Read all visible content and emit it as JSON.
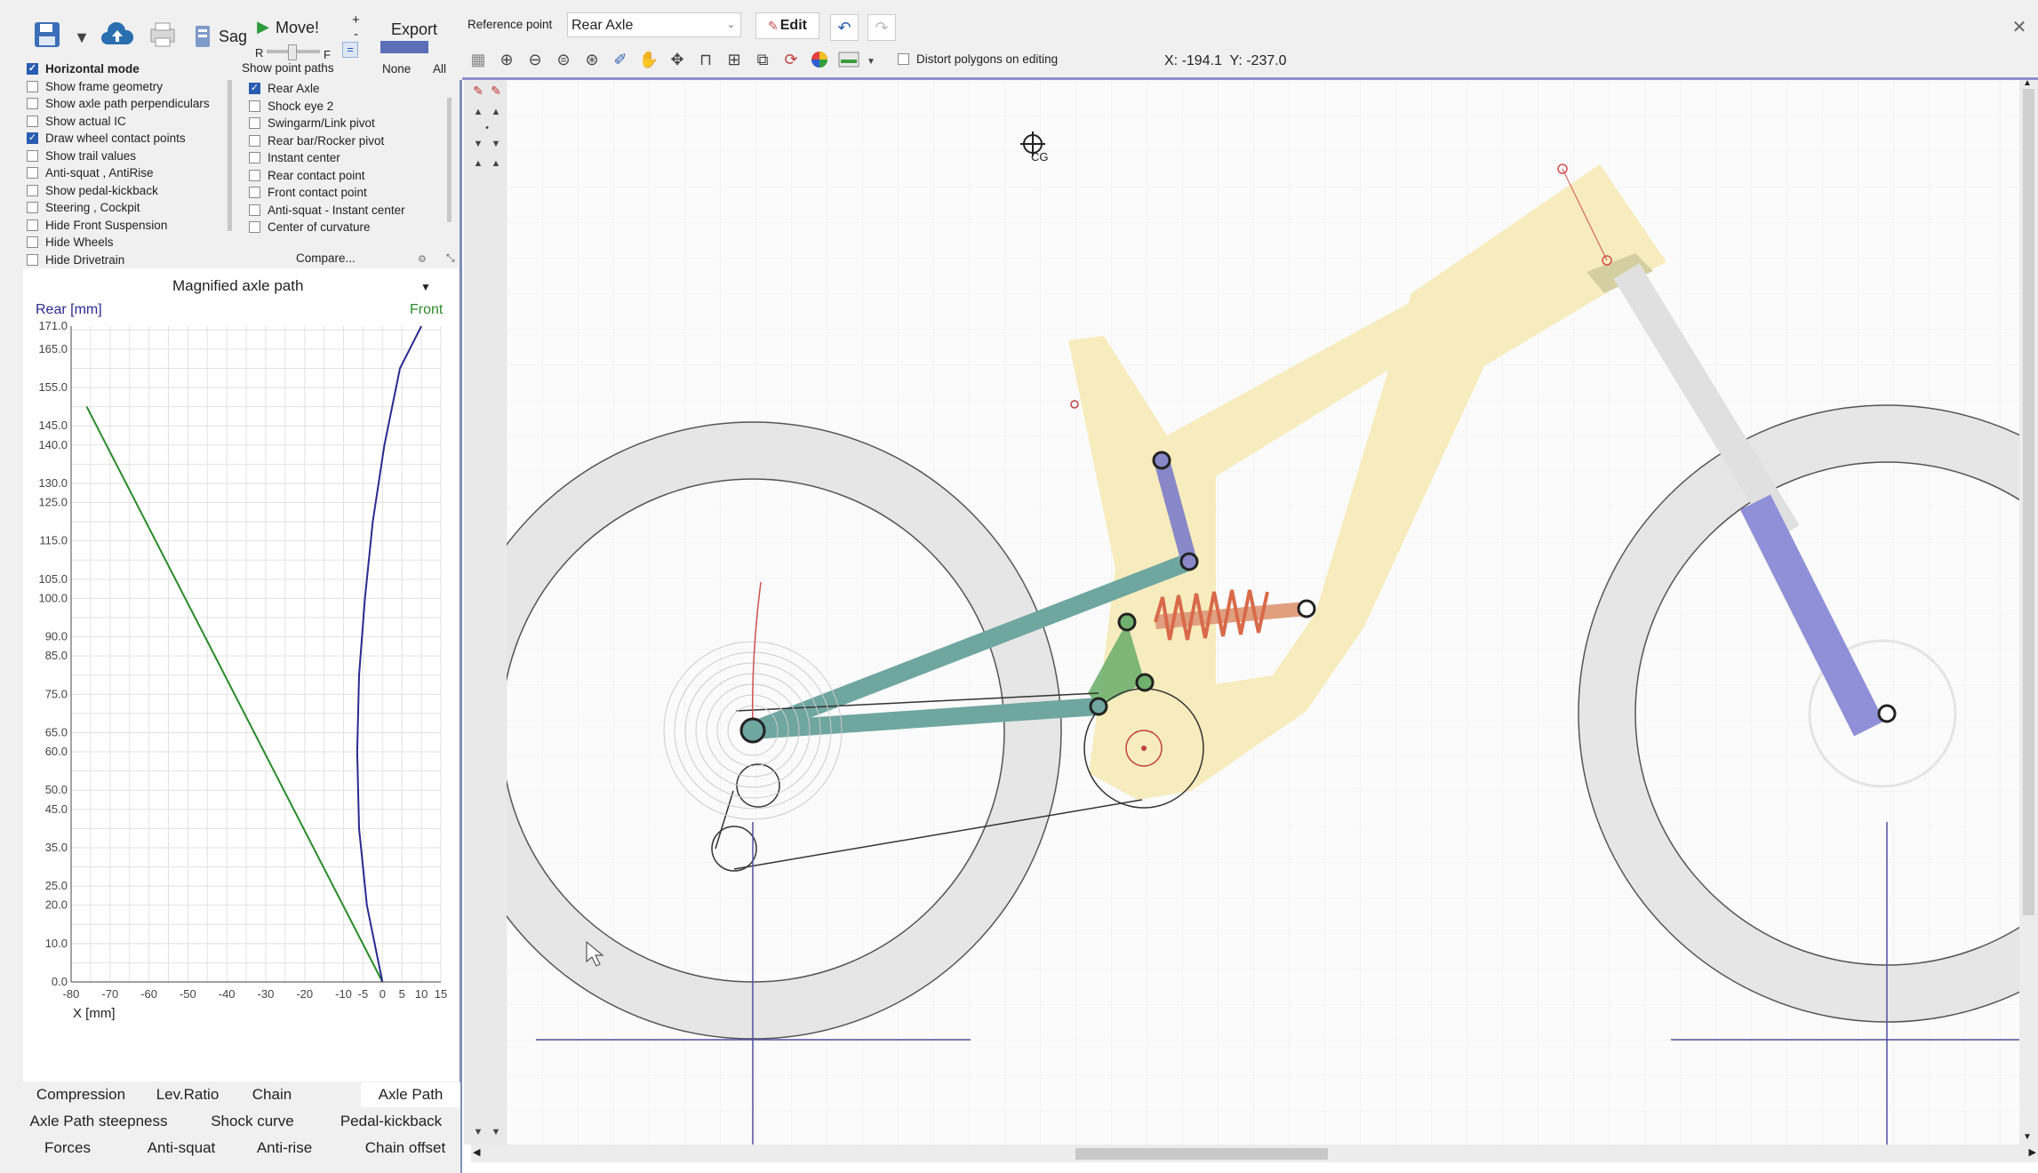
{
  "toolbar": {
    "sag_label": "Sag",
    "move_label": "Move!",
    "export_label": "Export",
    "slider_r": "R",
    "slider_f": "F",
    "plus_label": "+",
    "minus_label": "-",
    "equal_label": "="
  },
  "options": [
    {
      "label": "Horizontal mode",
      "checked": true,
      "bold": true
    },
    {
      "label": "Show frame geometry",
      "checked": false
    },
    {
      "label": "Show axle path perpendiculars",
      "checked": false
    },
    {
      "label": "Show actual IC",
      "checked": false
    },
    {
      "label": "Draw wheel contact points",
      "checked": true
    },
    {
      "label": "Show trail values",
      "checked": false
    },
    {
      "label": "Anti-squat , AntiRise",
      "checked": false
    },
    {
      "label": "Show pedal-kickback",
      "checked": false
    },
    {
      "label": "Steering , Cockpit",
      "checked": false
    },
    {
      "label": "Hide Front Suspension",
      "checked": false
    },
    {
      "label": "Hide Wheels",
      "checked": false
    },
    {
      "label": "Hide Drivetrain",
      "checked": false
    }
  ],
  "point_paths": {
    "header": "Show point paths",
    "none_label": "None",
    "all_label": "All",
    "compare_label": "Compare...",
    "items": [
      {
        "label": "Rear Axle",
        "checked": true
      },
      {
        "label": "Shock eye 2",
        "checked": false
      },
      {
        "label": "Swingarm/Link pivot",
        "checked": false
      },
      {
        "label": "Rear bar/Rocker pivot",
        "checked": false
      },
      {
        "label": "Instant center",
        "checked": false
      },
      {
        "label": "Rear contact point",
        "checked": false
      },
      {
        "label": "Front contact point",
        "checked": false
      },
      {
        "label": "Anti-squat - Instant center",
        "checked": false
      },
      {
        "label": "Center of curvature",
        "checked": false
      }
    ]
  },
  "graph": {
    "selector": "Magnified axle path",
    "rear_label": "Rear [mm]",
    "front_label": "Front"
  },
  "chart_data": {
    "type": "line",
    "xlabel": "X [mm]",
    "ylabel": "",
    "xlim": [
      -80,
      15
    ],
    "ylim": [
      0,
      171
    ],
    "xticks": [
      -80,
      -70,
      -60,
      -50,
      -40,
      -30,
      -20,
      -10,
      -5,
      0,
      5,
      10,
      15
    ],
    "yticks": [
      0.0,
      10.0,
      20.0,
      25.0,
      35.0,
      45.0,
      50.0,
      60.0,
      65.0,
      75.0,
      85.0,
      90.0,
      100.0,
      105.0,
      115.0,
      125.0,
      130.0,
      140.0,
      145.0,
      155.0,
      165.0,
      171.0
    ],
    "grid": true,
    "series": [
      {
        "color": "#2a8a2a",
        "points": [
          [
            -76,
            150
          ],
          [
            0,
            0
          ]
        ]
      },
      {
        "color": "#2a2a90",
        "points": [
          [
            0,
            0
          ],
          [
            -4,
            20
          ],
          [
            -6,
            40
          ],
          [
            -6.5,
            60
          ],
          [
            -6,
            80
          ],
          [
            -4.5,
            100
          ],
          [
            -2.5,
            120
          ],
          [
            0.5,
            140
          ],
          [
            4.5,
            160
          ],
          [
            10,
            171
          ]
        ]
      }
    ]
  },
  "bottom_tabs": [
    {
      "label": "Compression",
      "active": false
    },
    {
      "label": "Lev.Ratio",
      "active": false
    },
    {
      "label": "Chain",
      "active": false
    },
    {
      "label": "Axle Path",
      "active": true
    },
    {
      "label": "Axle Path steepness",
      "active": false
    },
    {
      "label": "Shock curve",
      "active": false
    },
    {
      "label": "Pedal-kickback",
      "active": false
    },
    {
      "label": "Forces",
      "active": false
    },
    {
      "label": "Anti-squat",
      "active": false
    },
    {
      "label": "Anti-rise",
      "active": false
    },
    {
      "label": "Chain offset",
      "active": false
    }
  ],
  "canvas_toolbar": {
    "reference_label": "Reference point",
    "reference_value": "Rear Axle",
    "edit_label": "Edit",
    "distort_label": "Distort polygons on editing",
    "coords": "X: -194.1  Y: -237.0"
  },
  "canvas": {
    "cg_label": "CG",
    "colors": {
      "frame": "#f7ebb9",
      "link": "#6fa6a0",
      "rocker": "#8888c8",
      "fork_lower": "#9090d8",
      "spring": "#e09070",
      "tire": "#e6e6e6"
    }
  }
}
